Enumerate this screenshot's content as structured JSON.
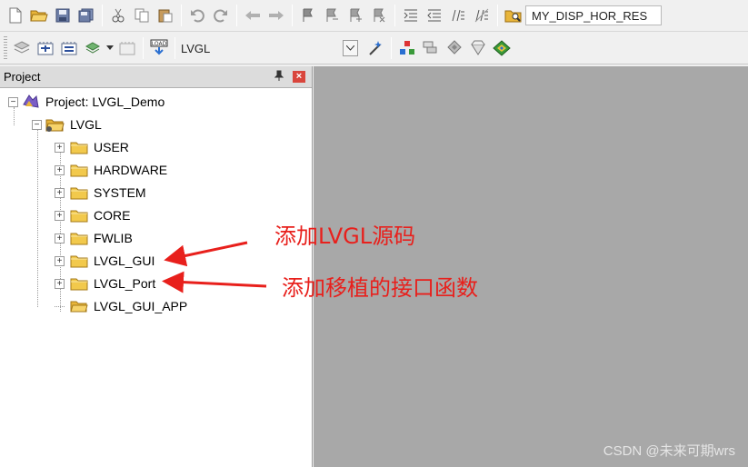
{
  "toolbar1": {
    "find_value": "MY_DISP_HOR_RES",
    "icons": [
      "new-file-icon",
      "open-file-icon",
      "save-icon",
      "save-all-icon",
      "cut-icon",
      "copy-icon",
      "paste-icon",
      "undo-icon",
      "redo-icon",
      "navigate-back-icon",
      "navigate-forward-icon",
      "bookmark-icon",
      "prev-bookmark-icon",
      "next-bookmark-icon",
      "clear-bookmarks-icon",
      "indent-icon",
      "unindent-icon",
      "comment-icon",
      "uncomment-icon",
      "find-in-files-icon"
    ]
  },
  "toolbar2": {
    "target_value": "LVGL",
    "load_label": "LOAD"
  },
  "panel": {
    "title": "Project",
    "pin": "ᵖ",
    "close": "×"
  },
  "tree": {
    "root": "Project: LVGL_Demo",
    "target": "LVGL",
    "groups": [
      "USER",
      "HARDWARE",
      "SYSTEM",
      "CORE",
      "FWLIB",
      "LVGL_GUI",
      "LVGL_Port",
      "LVGL_GUI_APP"
    ]
  },
  "annotations": {
    "first": "添加LVGL源码",
    "second": "添加移植的接口函数"
  },
  "watermark": "CSDN @未来可期wrs",
  "colors": {
    "annotation": "#e8201c",
    "editor_bg": "#a8a8a8",
    "folder": "#f2c94c"
  }
}
